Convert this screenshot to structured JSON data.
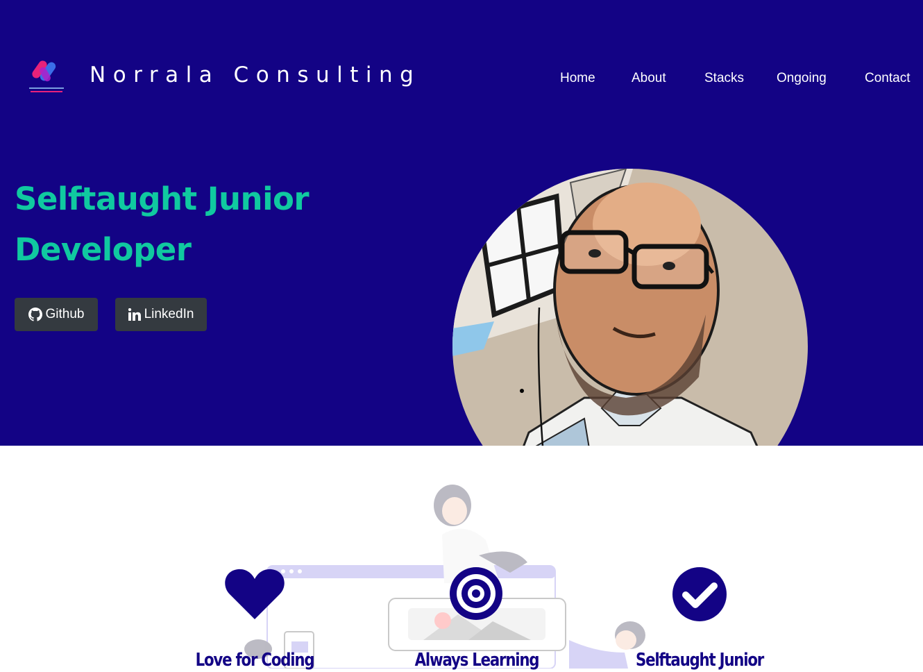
{
  "brand": {
    "name": "Norrala Consulting"
  },
  "nav": {
    "items": [
      "Home",
      "About",
      "Stacks",
      "Ongoing",
      "Contact"
    ]
  },
  "hero": {
    "title_line1": "Selftaught Junior",
    "title_line2": "Developer",
    "buttons": [
      {
        "label": "Github",
        "icon": "github-icon"
      },
      {
        "label": "LinkedIn",
        "icon": "linkedin-icon"
      }
    ]
  },
  "features": [
    {
      "title": "Love for Coding",
      "icon": "heart-icon"
    },
    {
      "title": "Always Learning",
      "icon": "bullseye-icon"
    },
    {
      "title": "Selftaught Junior",
      "icon": "check-circle-icon"
    }
  ],
  "colors": {
    "hero_background": "#130385",
    "title_accent": "#10c9a0",
    "button_background": "#343a40",
    "feature_color": "#130385"
  }
}
